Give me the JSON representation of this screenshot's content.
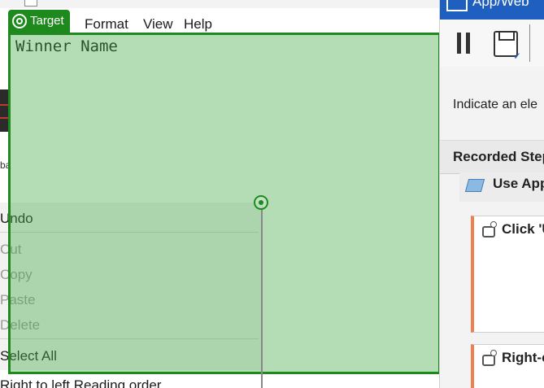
{
  "notepad": {
    "menu": [
      "Format",
      "View",
      "Help"
    ],
    "editor_text": "Winner Name",
    "side_label": "ba"
  },
  "overlay": {
    "badge_label": "Target",
    "color": "#1e8a1e"
  },
  "context_menu": {
    "items": [
      {
        "label": "Undo",
        "enabled": true
      },
      {
        "label": "Cut",
        "enabled": false
      },
      {
        "label": "Copy",
        "enabled": false
      },
      {
        "label": "Paste",
        "enabled": false
      },
      {
        "label": "Delete",
        "enabled": false
      },
      {
        "label": "Select All",
        "enabled": true
      }
    ],
    "below_item": "Right to left Reading order"
  },
  "recorder": {
    "title": "App/Web",
    "title_color": "#1f5fbf",
    "indicate_text": "Indicate an ele",
    "steps_header": "Recorded Step",
    "use_app_step": "Use App",
    "step_cards": [
      "Click 'U",
      "Right-c"
    ],
    "accent": "#f08050"
  }
}
